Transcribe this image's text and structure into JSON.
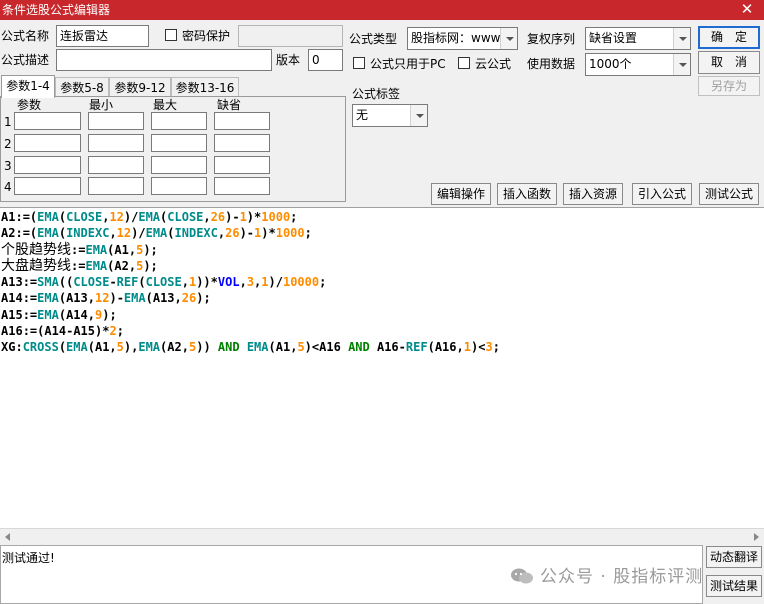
{
  "window": {
    "title": "条件选股公式编辑器"
  },
  "form": {
    "name_label": "公式名称",
    "name_value": "连扳雷达",
    "password_label": "密码保护",
    "password_value": "",
    "desc_label": "公式描述",
    "desc_value": "",
    "version_label": "版本",
    "version_value": "0",
    "type_label": "公式类型",
    "type_value": "股指标网：www",
    "rights_label": "复权序列",
    "rights_value": "缺省设置",
    "pc_only_label": "公式只用于PC",
    "cloud_label": "云公式",
    "data_label": "使用数据",
    "data_value": "1000个",
    "tag_label": "公式标签",
    "tag_value": "无"
  },
  "buttons": {
    "ok": "确　定",
    "cancel": "取　消",
    "save_as": "另存为",
    "edit_ops": "编辑操作",
    "insert_func": "插入函数",
    "insert_res": "插入资源",
    "import": "引入公式",
    "test": "测试公式",
    "translate": "动态翻译",
    "test_result": "测试结果"
  },
  "params": {
    "tabs": [
      "参数1-4",
      "参数5-8",
      "参数9-12",
      "参数13-16"
    ],
    "headers": [
      "参数",
      "最小",
      "最大",
      "缺省"
    ],
    "rows": [
      "1",
      "2",
      "3",
      "4"
    ]
  },
  "code": {
    "lines": [
      "A1:=(EMA(CLOSE,12)/EMA(CLOSE,26)-1)*1000;",
      "A2:=(EMA(INDEXC,12)/EMA(INDEXC,26)-1)*1000;",
      "个股趋势线:=EMA(A1,5);",
      "大盘趋势线:=EMA(A2,5);",
      "A13:=SMA((CLOSE-REF(CLOSE,1))*VOL,3,1)/10000;",
      "A14:=EMA(A13,12)-EMA(A13,26);",
      "A15:=EMA(A14,9);",
      "A16:=(A14-A15)*2;",
      "XG:CROSS(EMA(A1,5),EMA(A2,5)) AND EMA(A1,5)<A16 AND A16-REF(A16,1)<3;"
    ]
  },
  "status": {
    "text": "测试通过!"
  },
  "watermark": {
    "text": "公众号 · 股指标评测"
  },
  "colors": {
    "titlebar": "#c8282c",
    "function": "#008b8b",
    "number": "#ff8c00",
    "keyword": "#008000",
    "variable": "#0000ff"
  }
}
